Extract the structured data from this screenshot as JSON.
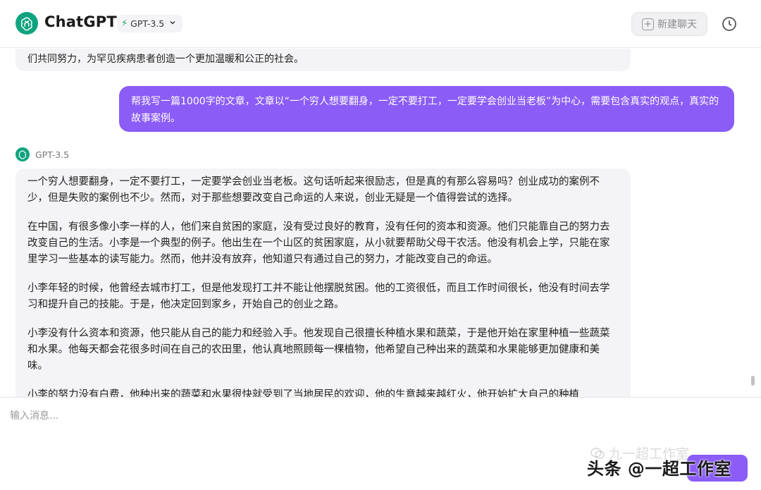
{
  "header": {
    "brand": "ChatGPT",
    "model_selector": "GPT-3.5",
    "new_chat_label": "新建聊天",
    "icons": {
      "logo": "openai-logo-icon",
      "bolt": "bolt-icon",
      "chevron": "chevron-down-icon",
      "history": "clock-icon",
      "new_chat": "plus-square-icon"
    }
  },
  "conversation": {
    "previous_message_tail": "们共同努力，为罕见疾病患者创造一个更加温暖和公正的社会。",
    "user_message": "帮我写一篇1000字的文章，文章以“一个穷人想要翻身，一定不要打工，一定要学会创业当老板”为中心，需要包含真实的观点，真实的故事案例。",
    "assistant_model_label": "GPT-3.5",
    "assistant_paragraphs": [
      "一个穷人想要翻身，一定不要打工，一定要学会创业当老板。这句话听起来很励志，但是真的有那么容易吗？创业成功的案例不少，但是失败的案例也不少。然而，对于那些想要改变自己命运的人来说，创业无疑是一个值得尝试的选择。",
      "在中国，有很多像小李一样的人，他们来自贫困的家庭，没有受过良好的教育，没有任何的资本和资源。他们只能靠自己的努力去改变自己的生活。小李是一个典型的例子。他出生在一个山区的贫困家庭，从小就要帮助父母干农活。他没有机会上学，只能在家里学习一些基本的读写能力。然而，他并没有放弃，他知道只有通过自己的努力，才能改变自己的命运。",
      "小李年轻的时候，他曾经去城市打工，但是他发现打工并不能让他摆脱贫困。他的工资很低，而且工作时间很长，他没有时间去学习和提升自己的技能。于是，他决定回到家乡，开始自己的创业之路。",
      "小李没有什么资本和资源，他只能从自己的能力和经验入手。他发现自己很擅长种植水果和蔬菜，于是他开始在家里种植一些蔬菜和水果。他每天都会花很多时间在自己的农田里，他认真地照顾每一棵植物，他希望自己种出来的蔬菜和水果能够更加健康和美味。",
      "小李的努力没有白费，他种出来的蔬菜和水果很快就受到了当地居民的欢迎，他的生意越来越红火，他开始扩大自己的种植"
    ]
  },
  "input": {
    "placeholder": "输入消息..."
  },
  "watermark": {
    "faint": "九一超工作室",
    "main": "头条 @一超工作室"
  },
  "colors": {
    "accent": "#8b5cf6",
    "brand_green": "#10a37f",
    "bubble_bg": "#f4f4f6"
  }
}
